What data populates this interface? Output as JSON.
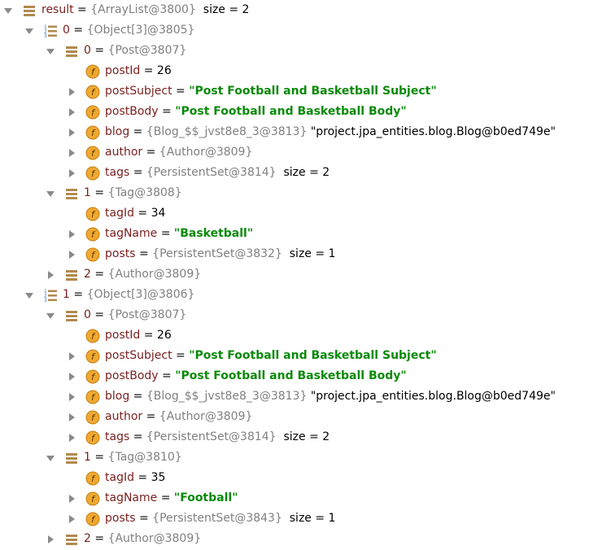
{
  "colors": {
    "field_name": "#7a1f1f",
    "type_ref": "#808080",
    "string_value": "#0a8a0a",
    "icon_field": "#f0a830",
    "icon_list": "#b08a50",
    "icon_array": "#3b6fb6"
  },
  "rows": [
    {
      "depth": 0,
      "toggle": "expanded",
      "icon": "list-icon",
      "name": "result",
      "eq": " = ",
      "typeref": "{ArrayList@3800}",
      "extra": "  size = 2"
    },
    {
      "depth": 1,
      "toggle": "expanded",
      "icon": "array-icon",
      "name": "0",
      "eq": " = ",
      "typeref": "{Object[3]@3805}"
    },
    {
      "depth": 2,
      "toggle": "expanded",
      "icon": "list-icon",
      "name": "0",
      "eq": " = ",
      "typeref": "{Post@3807}"
    },
    {
      "depth": 3,
      "toggle": "none",
      "icon": "field-icon",
      "name": "postId",
      "eq": " = ",
      "value": "26",
      "value_type": "num"
    },
    {
      "depth": 3,
      "toggle": "collapsed",
      "icon": "field-icon",
      "name": "postSubject",
      "eq": " = ",
      "value": "\"Post Football and Basketball Subject\"",
      "value_type": "str"
    },
    {
      "depth": 3,
      "toggle": "collapsed",
      "icon": "field-icon",
      "name": "postBody",
      "eq": " = ",
      "value": "\"Post Football and Basketball Body\"",
      "value_type": "str"
    },
    {
      "depth": 3,
      "toggle": "collapsed",
      "icon": "field-icon",
      "name": "blog",
      "eq": " = ",
      "typeref": "{Blog_$$_jvst8e8_3@3813}",
      "extra": " \"project.jpa_entities.blog.Blog@b0ed749e\""
    },
    {
      "depth": 3,
      "toggle": "collapsed",
      "icon": "field-icon",
      "name": "author",
      "eq": " = ",
      "typeref": "{Author@3809}"
    },
    {
      "depth": 3,
      "toggle": "collapsed",
      "icon": "field-icon",
      "name": "tags",
      "eq": " = ",
      "typeref": "{PersistentSet@3814}",
      "extra": "  size = 2"
    },
    {
      "depth": 2,
      "toggle": "expanded",
      "icon": "list-icon",
      "name": "1",
      "eq": " = ",
      "typeref": "{Tag@3808}"
    },
    {
      "depth": 3,
      "toggle": "none",
      "icon": "field-icon",
      "name": "tagId",
      "eq": " = ",
      "value": "34",
      "value_type": "num"
    },
    {
      "depth": 3,
      "toggle": "collapsed",
      "icon": "field-icon",
      "name": "tagName",
      "eq": " = ",
      "value": "\"Basketball\"",
      "value_type": "str"
    },
    {
      "depth": 3,
      "toggle": "collapsed",
      "icon": "field-icon",
      "name": "posts",
      "eq": " = ",
      "typeref": "{PersistentSet@3832}",
      "extra": "  size = 1"
    },
    {
      "depth": 2,
      "toggle": "collapsed",
      "icon": "list-icon",
      "name": "2",
      "eq": " = ",
      "typeref": "{Author@3809}"
    },
    {
      "depth": 1,
      "toggle": "expanded",
      "icon": "array-icon",
      "name": "1",
      "eq": " = ",
      "typeref": "{Object[3]@3806}"
    },
    {
      "depth": 2,
      "toggle": "expanded",
      "icon": "list-icon",
      "name": "0",
      "eq": " = ",
      "typeref": "{Post@3807}"
    },
    {
      "depth": 3,
      "toggle": "none",
      "icon": "field-icon",
      "name": "postId",
      "eq": " = ",
      "value": "26",
      "value_type": "num"
    },
    {
      "depth": 3,
      "toggle": "collapsed",
      "icon": "field-icon",
      "name": "postSubject",
      "eq": " = ",
      "value": "\"Post Football and Basketball Subject\"",
      "value_type": "str"
    },
    {
      "depth": 3,
      "toggle": "collapsed",
      "icon": "field-icon",
      "name": "postBody",
      "eq": " = ",
      "value": "\"Post Football and Basketball Body\"",
      "value_type": "str"
    },
    {
      "depth": 3,
      "toggle": "collapsed",
      "icon": "field-icon",
      "name": "blog",
      "eq": " = ",
      "typeref": "{Blog_$$_jvst8e8_3@3813}",
      "extra": " \"project.jpa_entities.blog.Blog@b0ed749e\""
    },
    {
      "depth": 3,
      "toggle": "collapsed",
      "icon": "field-icon",
      "name": "author",
      "eq": " = ",
      "typeref": "{Author@3809}"
    },
    {
      "depth": 3,
      "toggle": "collapsed",
      "icon": "field-icon",
      "name": "tags",
      "eq": " = ",
      "typeref": "{PersistentSet@3814}",
      "extra": "  size = 2"
    },
    {
      "depth": 2,
      "toggle": "expanded",
      "icon": "list-icon",
      "name": "1",
      "eq": " = ",
      "typeref": "{Tag@3810}"
    },
    {
      "depth": 3,
      "toggle": "none",
      "icon": "field-icon",
      "name": "tagId",
      "eq": " = ",
      "value": "35",
      "value_type": "num"
    },
    {
      "depth": 3,
      "toggle": "collapsed",
      "icon": "field-icon",
      "name": "tagName",
      "eq": " = ",
      "value": "\"Football\"",
      "value_type": "str"
    },
    {
      "depth": 3,
      "toggle": "collapsed",
      "icon": "field-icon",
      "name": "posts",
      "eq": " = ",
      "typeref": "{PersistentSet@3843}",
      "extra": "  size = 1"
    },
    {
      "depth": 2,
      "toggle": "collapsed",
      "icon": "list-icon",
      "name": "2",
      "eq": " = ",
      "typeref": "{Author@3809}"
    }
  ]
}
